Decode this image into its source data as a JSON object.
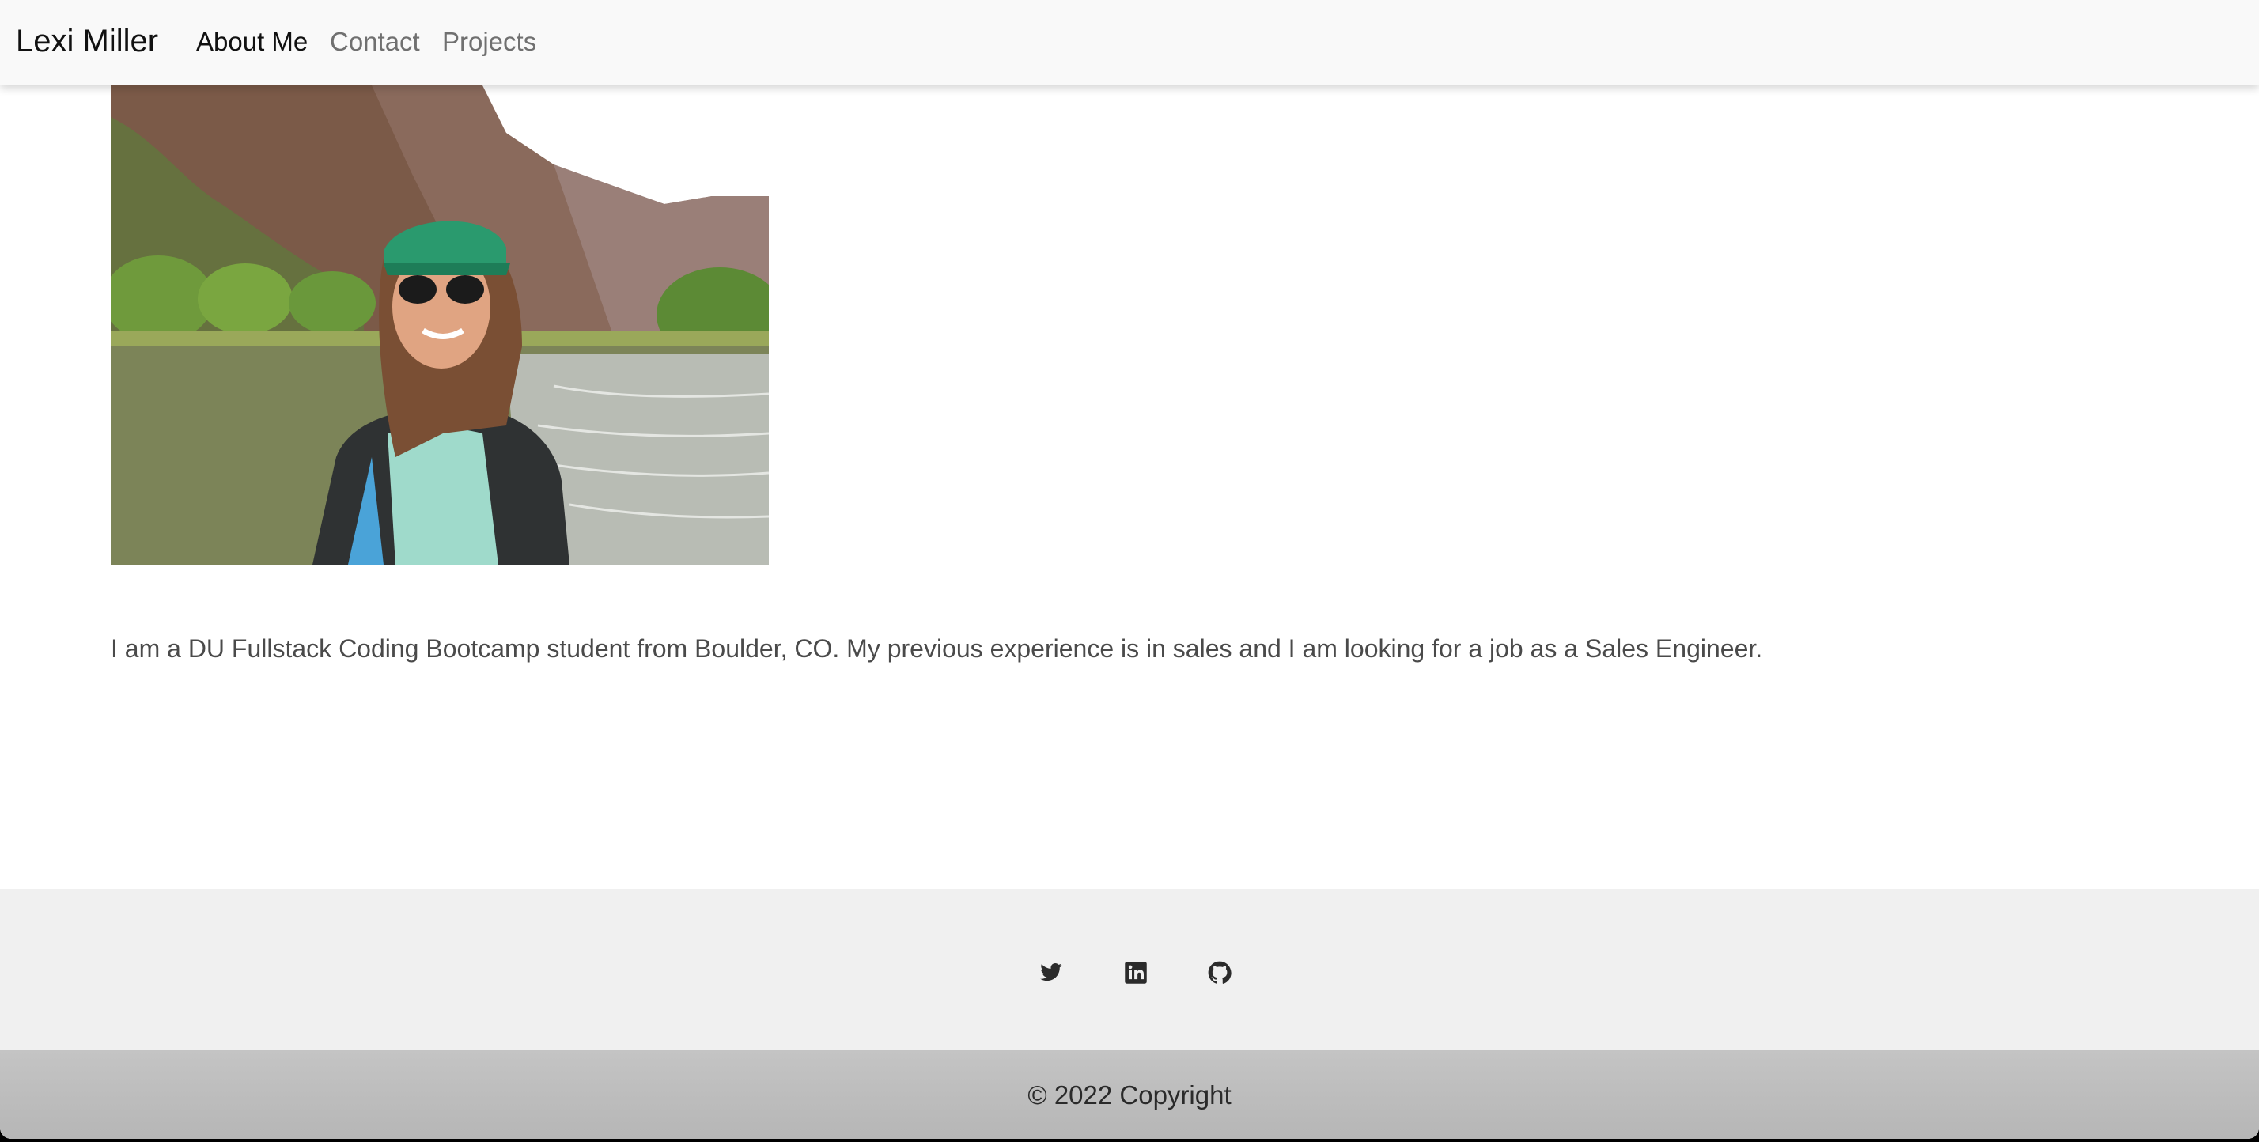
{
  "header": {
    "brand": "Lexi Miller",
    "nav": [
      {
        "label": "About Me",
        "active": true
      },
      {
        "label": "Contact",
        "active": false
      },
      {
        "label": "Projects",
        "active": false
      }
    ]
  },
  "about": {
    "photo_description": "photo of person on a river in a canyon",
    "bio": "I am a DU Fullstack Coding Bootcamp student from Boulder, CO. My previous experience is in sales and I am looking for a job as a Sales Engineer."
  },
  "footer": {
    "social": [
      {
        "name": "twitter",
        "icon": "twitter-icon"
      },
      {
        "name": "linkedin",
        "icon": "linkedin-icon"
      },
      {
        "name": "github",
        "icon": "github-icon"
      }
    ],
    "copyright": "© 2022 Copyright"
  },
  "colors": {
    "navbar_bg": "#f9f9f9",
    "nav_active": "#111111",
    "nav_inactive": "#707070",
    "footer_bg": "#f0f0f0",
    "copyright_bg": "#c0c0c0"
  }
}
